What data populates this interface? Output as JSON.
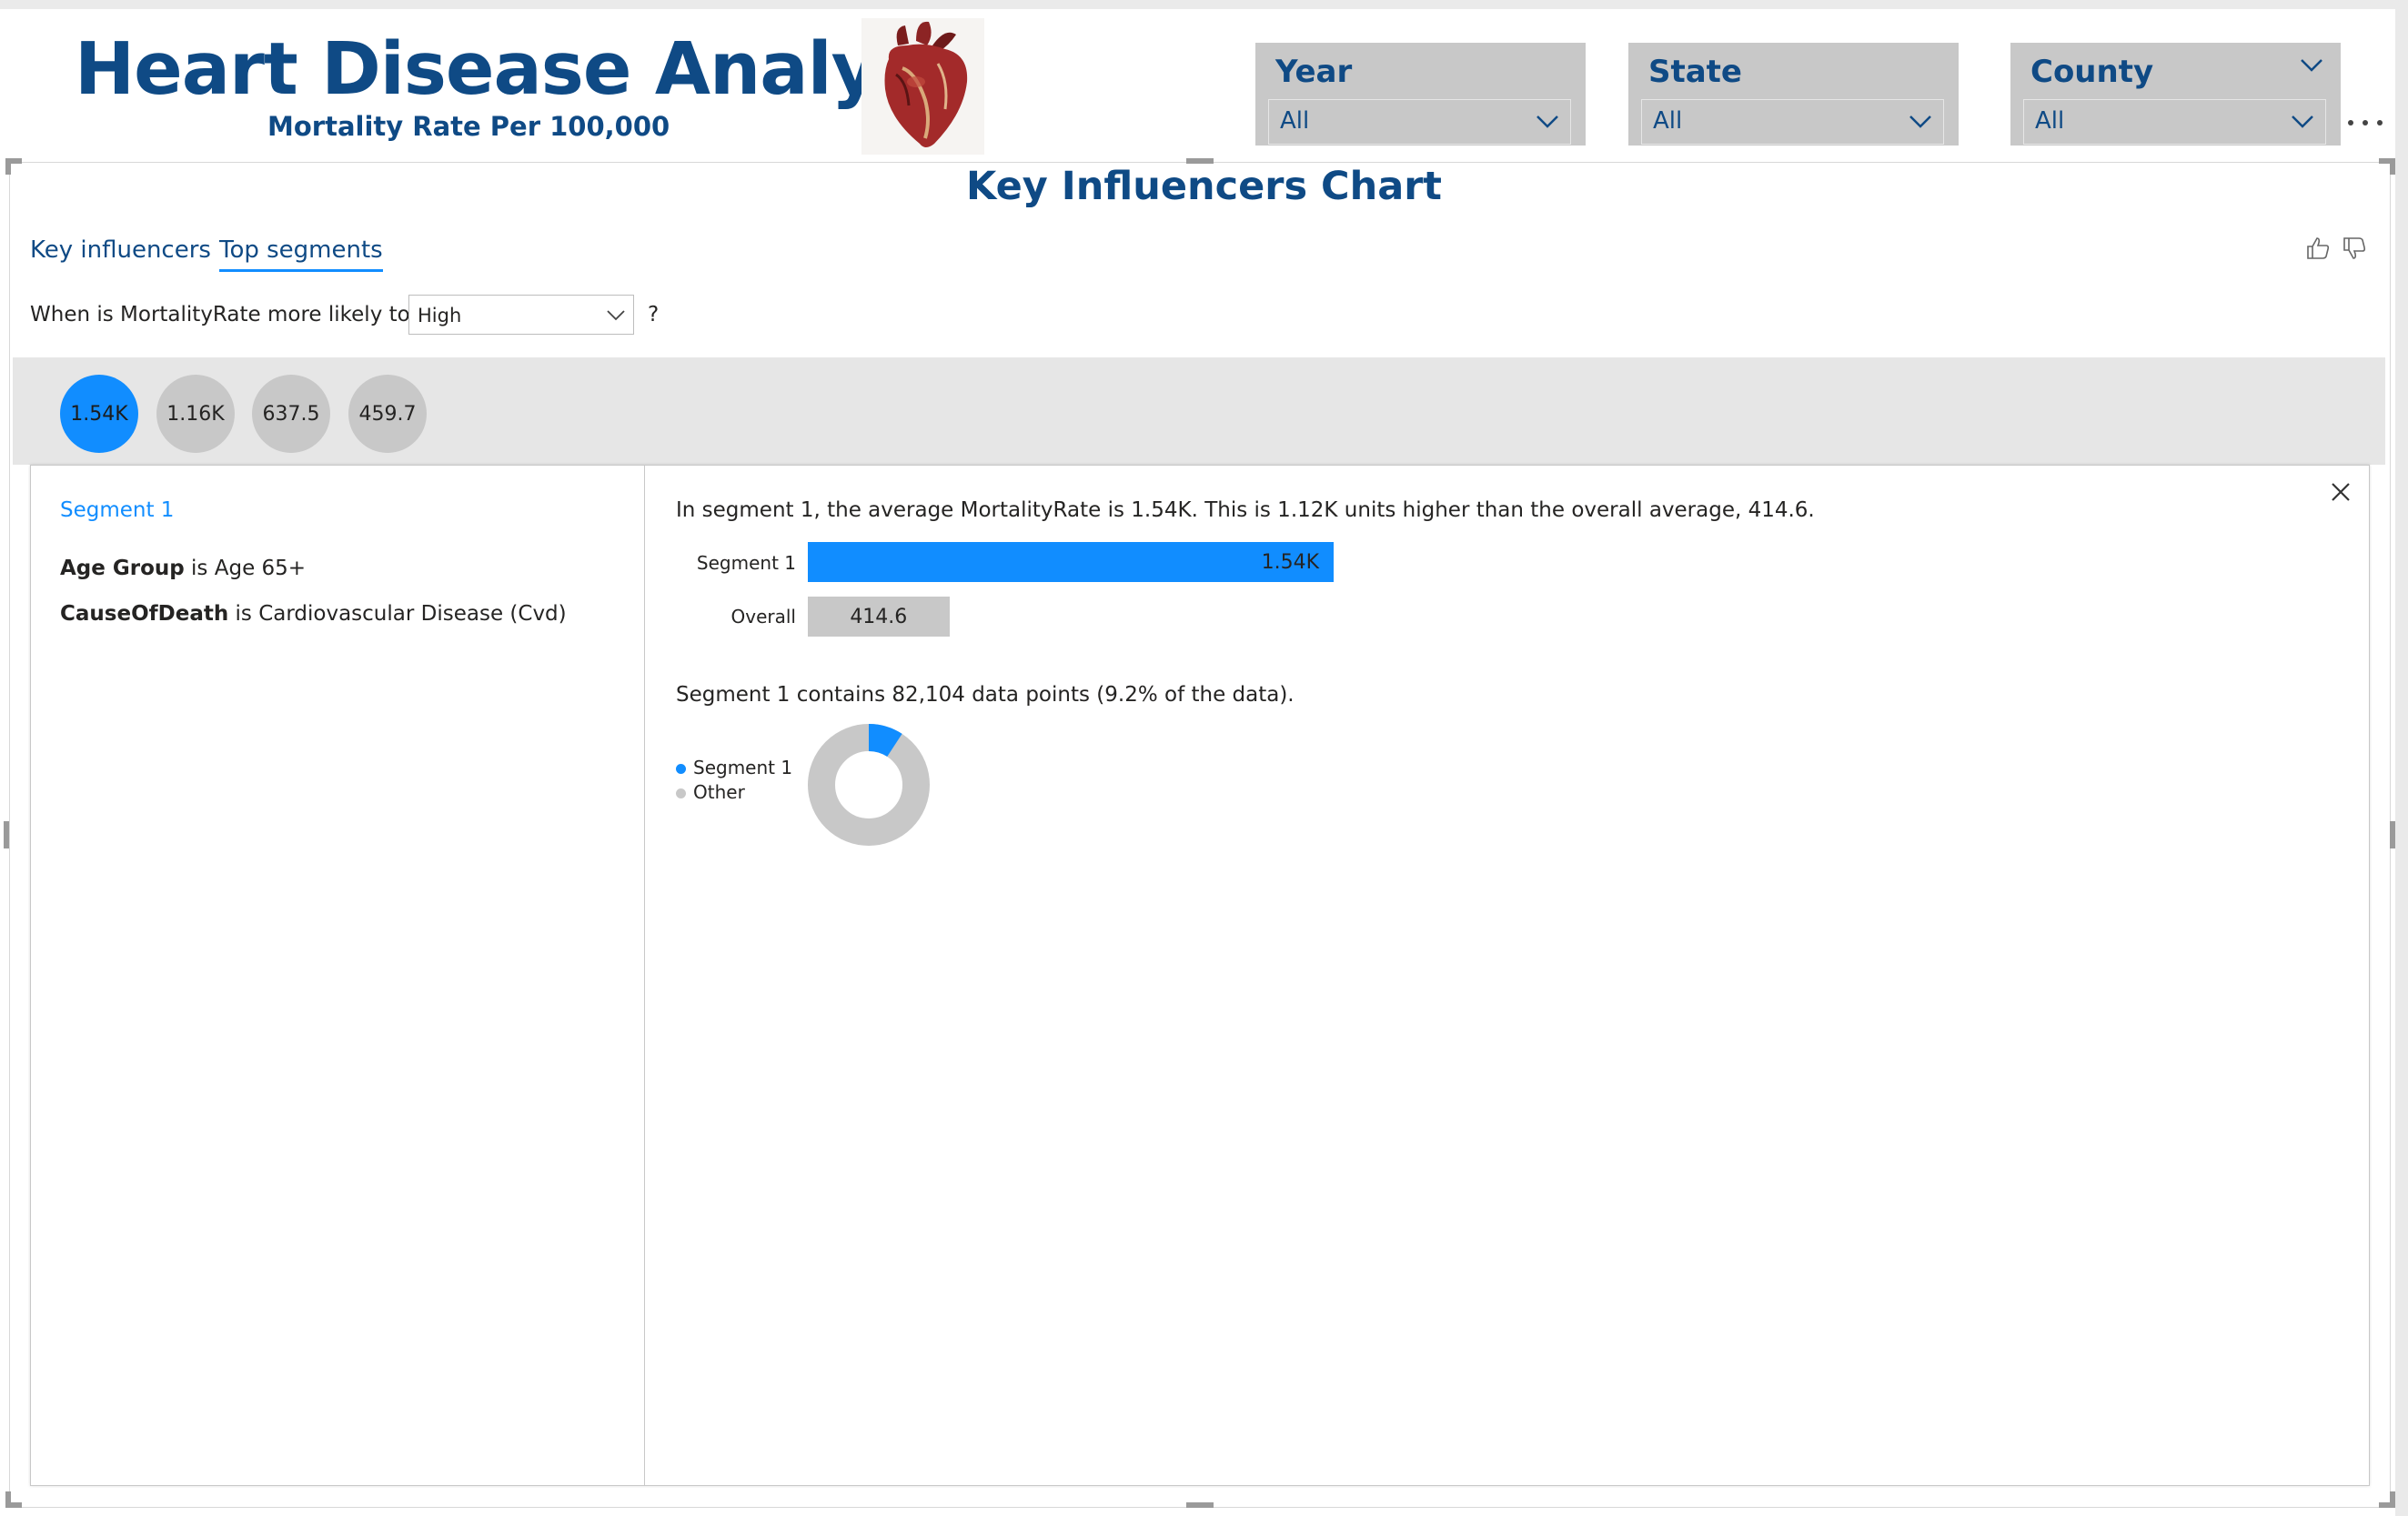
{
  "header": {
    "title": "Heart Disease Analysis",
    "subtitle": "Mortality Rate Per 100,000"
  },
  "slicers": [
    {
      "label": "Year",
      "value": "All"
    },
    {
      "label": "State",
      "value": "All"
    },
    {
      "label": "County",
      "value": "All"
    }
  ],
  "visual": {
    "title": "Key Influencers Chart",
    "tabs": {
      "key_influencers": "Key influencers",
      "top_segments": "Top segments"
    },
    "active_tab": "Top segments",
    "question": {
      "prefix": "When is MortalityRate more likely to be",
      "selected": "High",
      "suffix": "?"
    },
    "segments": [
      {
        "label": "1.54K",
        "active": true
      },
      {
        "label": "1.16K",
        "active": false
      },
      {
        "label": "637.5",
        "active": false
      },
      {
        "label": "459.7",
        "active": false
      }
    ]
  },
  "segment_detail": {
    "name": "Segment 1",
    "conditions": [
      {
        "field": "Age Group",
        "op": "is",
        "value": "Age 65+"
      },
      {
        "field": "CauseOfDeath",
        "op": "is",
        "value": "Cardiovascular Disease (Cvd)"
      }
    ],
    "summary": "In segment 1, the average MortalityRate is 1.54K. This is 1.12K units higher than the overall average, 414.6.",
    "bars": [
      {
        "label": "Segment 1",
        "value": 1540,
        "display": "1.54K"
      },
      {
        "label": "Overall",
        "value": 414.6,
        "display": "414.6"
      }
    ],
    "data_points_text": "Segment 1 contains 82,104 data points (9.2% of the data).",
    "legend": [
      {
        "label": "Segment 1",
        "color": "#118dff"
      },
      {
        "label": "Other",
        "color": "#c8c8c8"
      }
    ],
    "share_percent": 9.2
  },
  "colors": {
    "brand": "#0f4a85",
    "accent": "#118dff",
    "neutral": "#c8c8c8"
  }
}
